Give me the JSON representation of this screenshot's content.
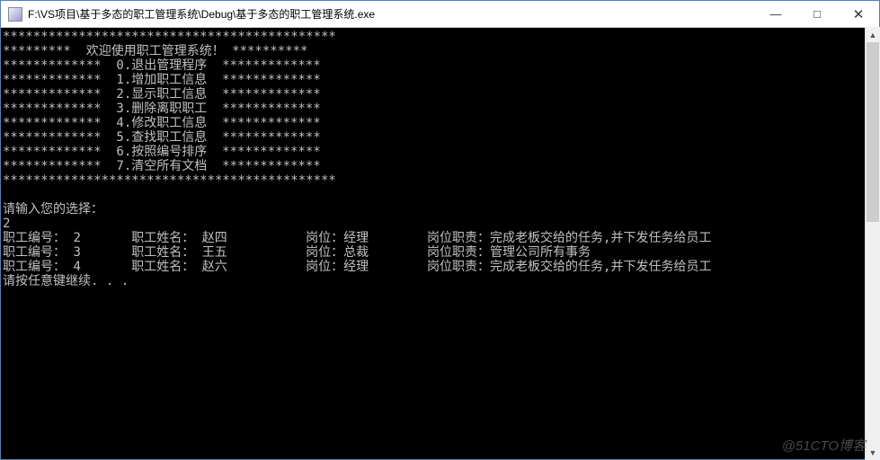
{
  "titlebar": {
    "title": "F:\\VS项目\\基于多态的职工管理系统\\Debug\\基于多态的职工管理系统.exe",
    "minimize": "—",
    "maximize": "□",
    "close": "✕"
  },
  "menu": {
    "border_top": "********************************************",
    "welcome": "*********  欢迎使用职工管理系统！ **********",
    "items": [
      "*************  0.退出管理程序  *************",
      "*************  1.增加职工信息  *************",
      "*************  2.显示职工信息  *************",
      "*************  3.删除离职职工  *************",
      "*************  4.修改职工信息  *************",
      "*************  5.查找职工信息  *************",
      "*************  6.按照编号排序  *************",
      "*************  7.清空所有文档  *************"
    ],
    "border_bottom": "********************************************"
  },
  "prompt": {
    "label": "请输入您的选择：",
    "input": "2"
  },
  "employees": {
    "headers": {
      "id": "职工编号：",
      "name": "职工姓名：",
      "post": "岗位：",
      "duty": "岗位职责："
    },
    "rows": [
      {
        "id": "2",
        "name": "赵四",
        "post": "经理",
        "duty": "完成老板交给的任务,并下发任务给员工"
      },
      {
        "id": "3",
        "name": "王五",
        "post": "总裁",
        "duty": "管理公司所有事务"
      },
      {
        "id": "4",
        "name": "赵六",
        "post": "经理",
        "duty": "完成老板交给的任务,并下发任务给员工"
      }
    ]
  },
  "continue_prompt": "请按任意键继续. . .",
  "watermark": "@51CTO博客"
}
